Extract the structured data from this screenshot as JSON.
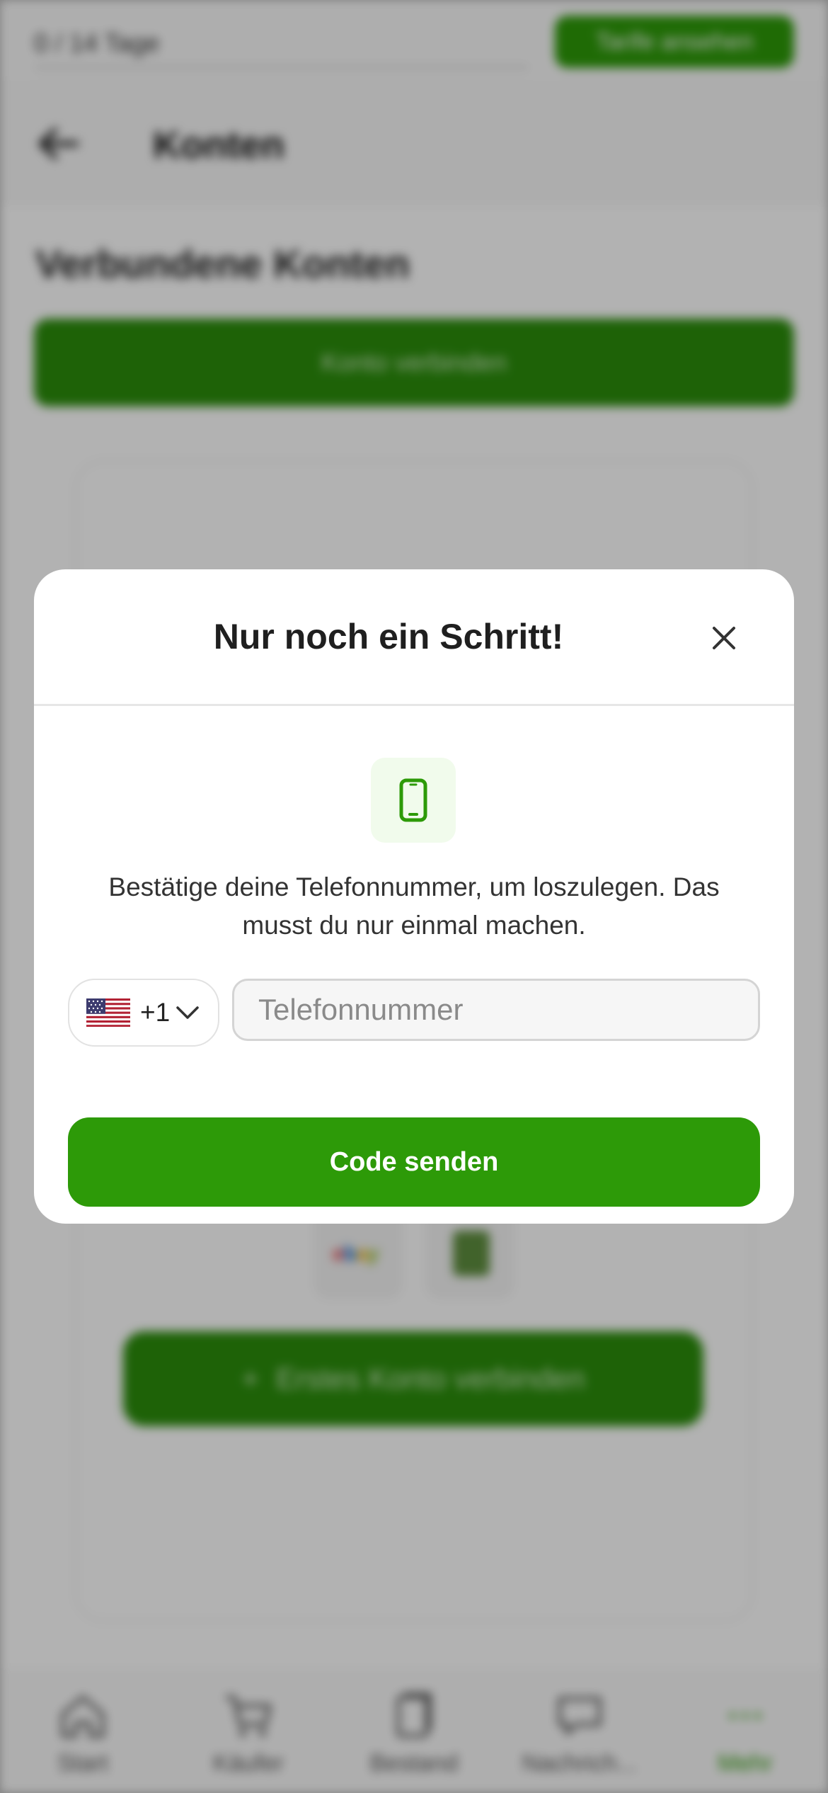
{
  "trial_bar": {
    "progress_text": "0 / 14 Tage",
    "plans_button": "Tarife ansehen"
  },
  "header": {
    "title": "Konten"
  },
  "page": {
    "section_title": "Verbundene Konten",
    "connect_button": "Konto verbinden",
    "first_account_button": "Erstes Konto verbinden",
    "platform_logos": [
      "ebay",
      "shopify"
    ]
  },
  "tabbar": {
    "items": [
      {
        "label": "Start",
        "icon": "home-icon"
      },
      {
        "label": "Käufer",
        "icon": "cart-icon"
      },
      {
        "label": "Bestand",
        "icon": "inventory-icon"
      },
      {
        "label": "Nachrich...",
        "icon": "chat-icon"
      },
      {
        "label": "Mehr",
        "icon": "more-icon",
        "active": true
      }
    ]
  },
  "modal": {
    "title": "Nur noch ein Schritt!",
    "icon": "smartphone-icon",
    "description": "Bestätige deine Telefonnummer, um loszulegen. Das musst du nur einmal machen.",
    "country": {
      "flag": "us-flag-icon",
      "dial_code": "+1"
    },
    "phone_input": {
      "value": "",
      "placeholder": "Telefonnummer"
    },
    "send_button": "Code senden"
  },
  "colors": {
    "accent": "#2d9a08",
    "accent_light": "#f1fbec",
    "overlay": "rgba(0,0,0,0.30)"
  }
}
